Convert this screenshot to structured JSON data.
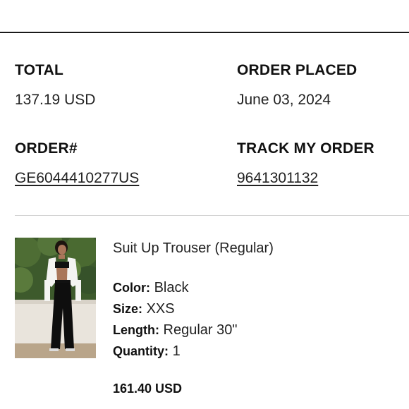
{
  "summary": {
    "total_label": "TOTAL",
    "total_value": "137.19 USD",
    "order_placed_label": "ORDER PLACED",
    "order_placed_value": "June 03, 2024",
    "order_number_label": "ORDER#",
    "order_number_value": "GE6044410277US",
    "track_label": "TRACK MY ORDER",
    "track_value": "9641301132"
  },
  "item": {
    "name": "Suit Up Trouser (Regular)",
    "color_label": "Color:",
    "color_value": "Black",
    "size_label": "Size:",
    "size_value": "XXS",
    "length_label": "Length:",
    "length_value": "Regular 30\"",
    "quantity_label": "Quantity:",
    "quantity_value": "1",
    "price": "161.40 USD"
  }
}
